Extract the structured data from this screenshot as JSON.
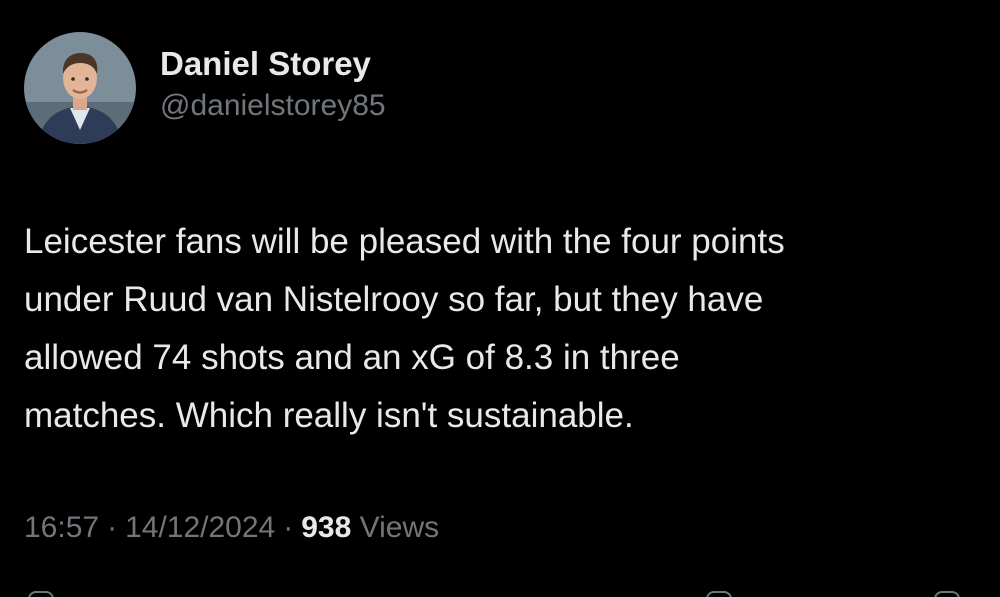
{
  "author": {
    "display_name": "Daniel Storey",
    "handle": "@danielstorey85",
    "avatar_icon": "profile-photo"
  },
  "tweet": {
    "text": "Leicester fans will be pleased with the four points\nunder Ruud van Nistelrooy so far, but they have\nallowed 74 shots and an xG of 8.3 in three\nmatches. Which really isn't sustainable."
  },
  "meta": {
    "time": "16:57",
    "separator": "·",
    "date": "14/12/2024",
    "views_count": "938",
    "views_label": "Views"
  },
  "actions": {
    "icons": [
      "reply-icon",
      "bookmark-icon",
      "share-icon"
    ]
  },
  "colors": {
    "background": "#000000",
    "primary_text": "#e7e9ea",
    "secondary_text": "#71767b"
  }
}
